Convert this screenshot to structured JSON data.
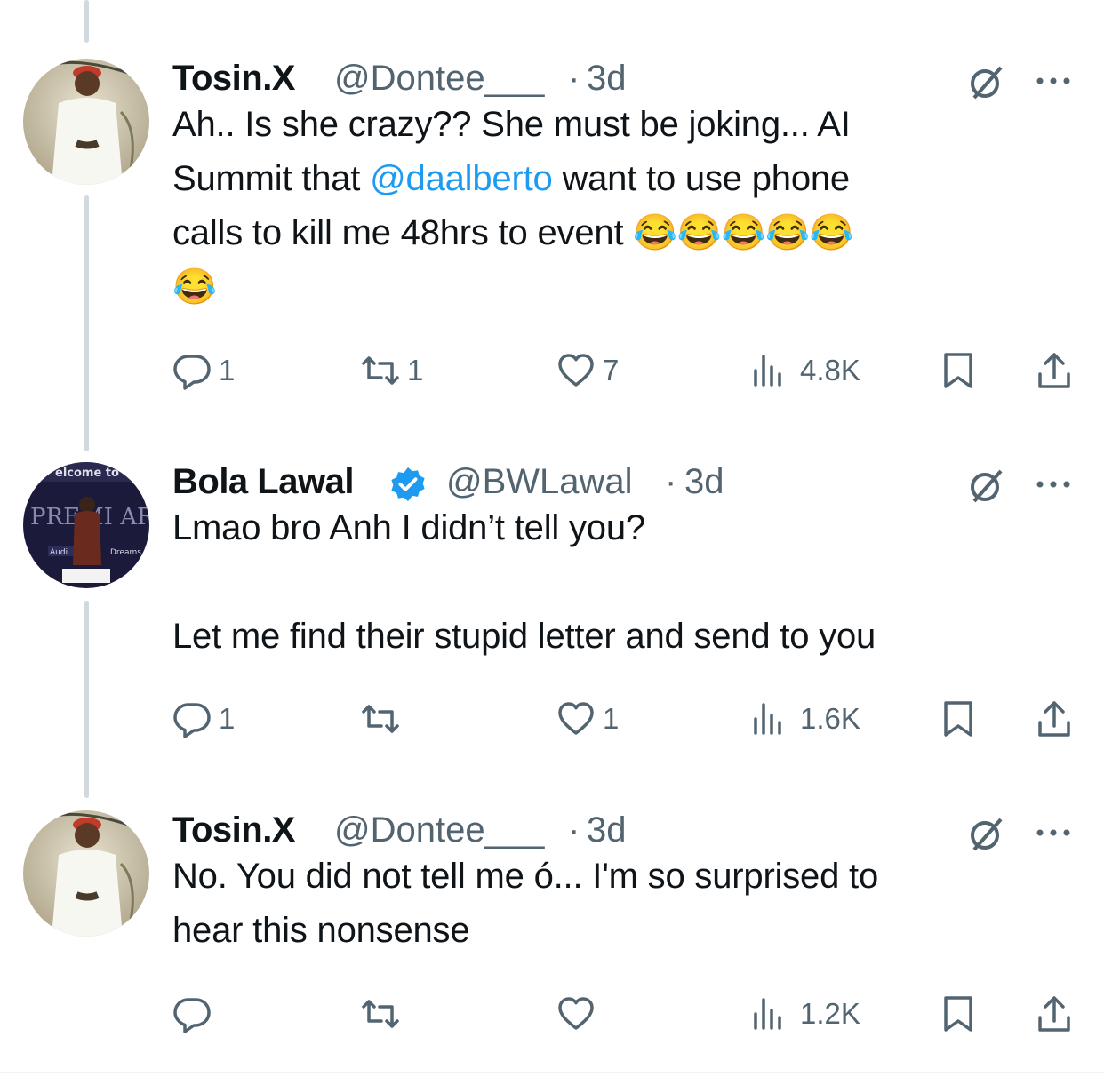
{
  "tweets": [
    {
      "name": "Tosin.X",
      "handle": "@Dontee___",
      "dot": "·",
      "time": "3d",
      "verified": false,
      "text_before": "Ah.. Is she crazy?? She must be joking... AI\nSummit that ",
      "mention": "@daalberto",
      "text_after": " want to use phone\ncalls to kill me 48hrs to event 😂😂😂😂😂\n😂",
      "replies": "1",
      "reposts": "1",
      "likes": "7",
      "views": "4.8K"
    },
    {
      "name": "Bola Lawal",
      "handle": "@BWLawal",
      "dot": "·",
      "time": "3d",
      "verified": true,
      "text": "Lmao bro Anh I didn’t tell you?\n\nLet me find their stupid letter and send to you",
      "replies": "1",
      "reposts": "",
      "likes": "1",
      "views": "1.6K"
    },
    {
      "name": "Tosin.X",
      "handle": "@Dontee___",
      "dot": "·",
      "time": "3d",
      "verified": false,
      "text": "No. You did not tell me ó... I'm so surprised to\nhear this nonsense",
      "replies": "",
      "reposts": "",
      "likes": "",
      "views": "1.2K"
    }
  ],
  "avatar2_text": {
    "welcome": "elcome to",
    "award": "PREMI  ARD",
    "left_tag": "Audi",
    "right_tag": "Dreams"
  },
  "colors": {
    "text": "#0f1419",
    "secondary": "#536471",
    "link": "#1d9bf0",
    "thread_line": "#cfd9de"
  },
  "icons": [
    "reply-icon",
    "repost-icon",
    "like-icon",
    "views-icon",
    "bookmark-icon",
    "share-icon",
    "grok-icon",
    "more-icon",
    "verified-badge-icon"
  ]
}
